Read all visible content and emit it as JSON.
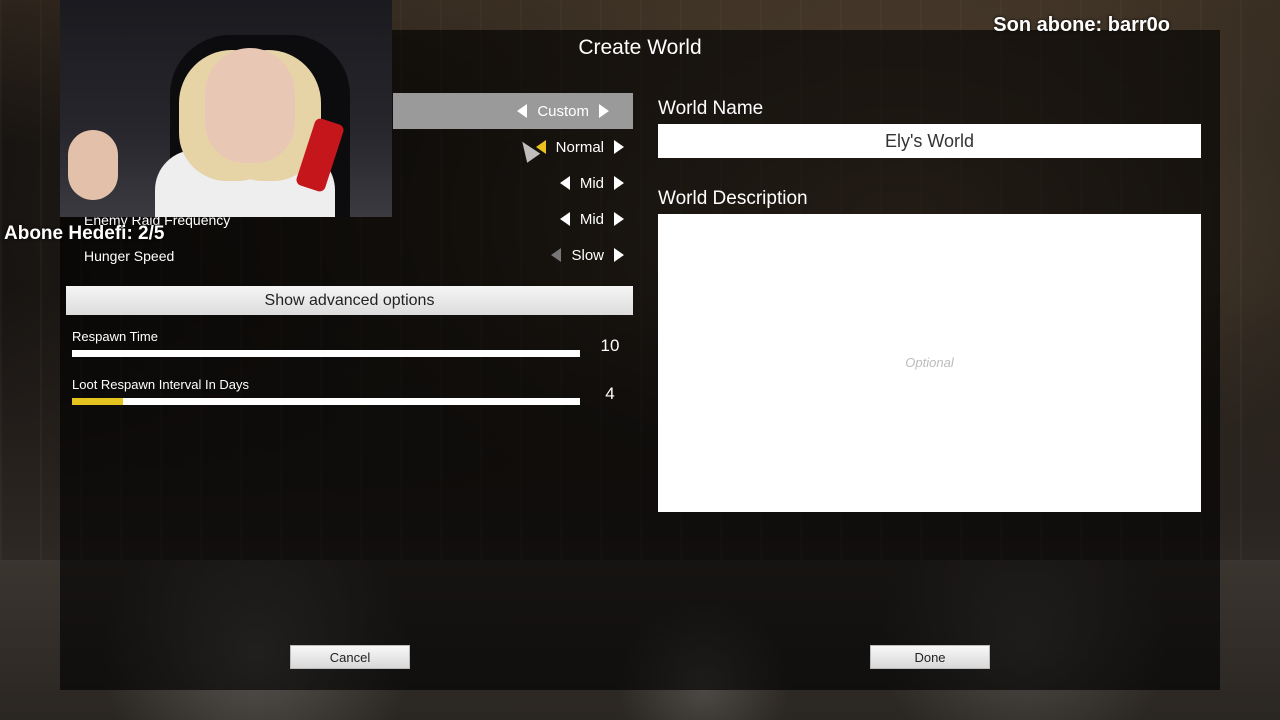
{
  "window_title": "Create World",
  "overlay": {
    "latest_sub": "Son abone: barr0o",
    "sub_goal": "Abone Hedefi: 2/5"
  },
  "settings": {
    "preset": "Custom",
    "rows": [
      {
        "label": "",
        "value": "Normal"
      },
      {
        "label": "",
        "value": "Mid"
      },
      {
        "label": "Enemy Raid Frequency",
        "value": "Mid"
      },
      {
        "label": "Hunger Speed",
        "value": "Slow"
      }
    ],
    "advanced_button": "Show advanced options"
  },
  "sliders": [
    {
      "label": "Respawn Time",
      "value": "10",
      "fill": 1.0
    },
    {
      "label": "Loot Respawn Interval In Days",
      "value": "4",
      "fill": 0.1
    }
  ],
  "world_name": {
    "label": "World Name",
    "value": "Ely's World"
  },
  "world_description": {
    "label": "World Description",
    "placeholder": "Optional"
  },
  "buttons": {
    "cancel": "Cancel",
    "done": "Done"
  },
  "colors": {
    "accent": "#e6c420",
    "highlight": "#9a9a9a"
  }
}
